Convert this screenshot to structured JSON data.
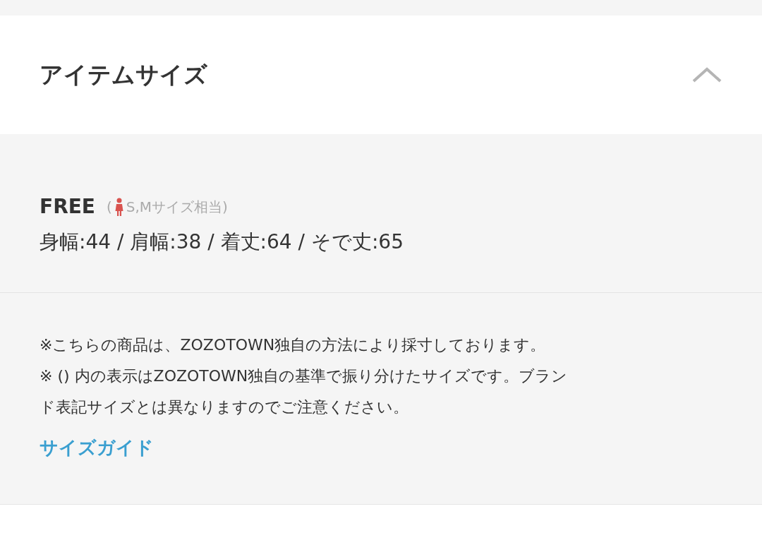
{
  "section": {
    "title": "アイテムサイズ",
    "expanded": true
  },
  "sizes": [
    {
      "name": "FREE",
      "open_paren": "(",
      "equivalent": "S,Mサイズ相当)",
      "measurements": "身幅:44 / 肩幅:38 / 着丈:64 / そで丈:65"
    }
  ],
  "notes": [
    "※こちらの商品は、ZOZOTOWN独自の方法により採寸しております。",
    "※ () 内の表示はZOZOTOWN独自の基準で振り分けたサイズです。ブランド表記サイズとは異なりますのでご注意ください。"
  ],
  "link": "サイズガイド"
}
